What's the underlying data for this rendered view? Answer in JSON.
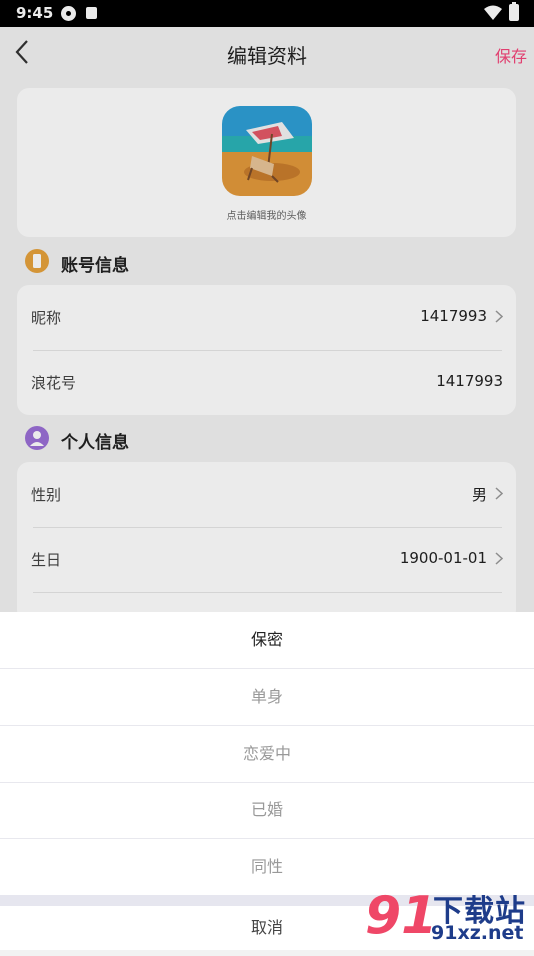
{
  "status_bar": {
    "time": "9:45"
  },
  "header": {
    "title": "编辑资料",
    "save_label": "保存"
  },
  "avatar": {
    "hint": "点击编辑我的头像"
  },
  "account_section": {
    "title": "账号信息",
    "rows": [
      {
        "label": "昵称",
        "value": "1417993"
      },
      {
        "label": "浪花号",
        "value": "1417993"
      }
    ]
  },
  "personal_section": {
    "title": "个人信息",
    "rows": [
      {
        "label": "性别",
        "value": "男"
      },
      {
        "label": "生日",
        "value": "1900-01-01"
      }
    ]
  },
  "sheet": {
    "options": [
      "保密",
      "单身",
      "恋爱中",
      "已婚",
      "同性"
    ],
    "selected_index": 0,
    "cancel_label": "取消"
  },
  "watermark": {
    "logo": "91",
    "name": "下载站",
    "url": "91xz.net"
  },
  "colors": {
    "accent": "#f5457a",
    "account_icon": "#e6a23c",
    "personal_icon": "#9b6fd6"
  }
}
